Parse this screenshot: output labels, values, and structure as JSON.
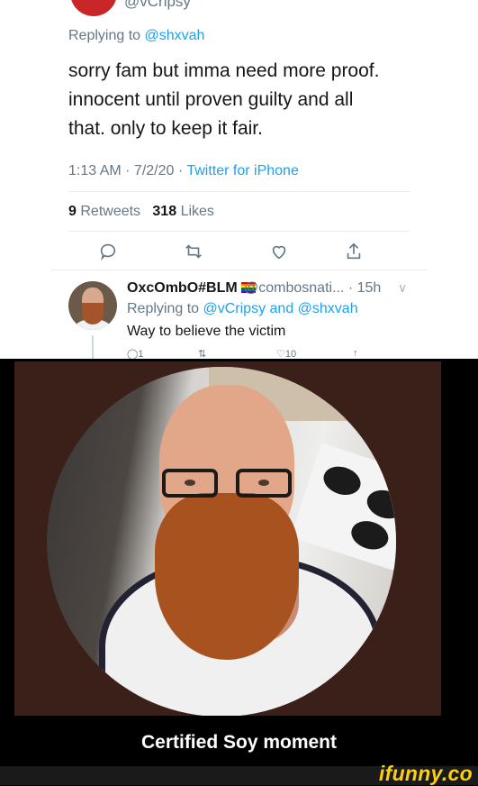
{
  "tweet": {
    "author_handle": "@vCripsy",
    "replying_prefix": "Replying to ",
    "replying_to": "@shxvah",
    "text_lines": [
      "sorry fam but imma need more proof.",
      "innocent until proven guilty and all",
      "that. only to keep it fair."
    ],
    "time": "1:13 AM · 7/2/20 · ",
    "source": "Twitter for iPhone",
    "retweets_count": "9",
    "retweets_label": "Retweets",
    "likes_count": "318",
    "likes_label": "Likes",
    "actions": [
      "reply-icon",
      "retweet-icon",
      "heart-icon",
      "share-icon"
    ]
  },
  "reply": {
    "display_name": "OxcOmbO#BLM",
    "handle_time": "@combosnati... · 15h",
    "chevron": "∨",
    "replying_prefix": "Replying to ",
    "replying_to": "@vCripsy and @shxvah",
    "text": "Way to believe the victim",
    "reply_count": "1",
    "like_count": "10"
  },
  "caption": "Certified Soy moment",
  "watermark": "ifunny.co",
  "colors": {
    "link": "#1da1f2",
    "muted": "#657786",
    "photo_background": "#3b1f19",
    "logo": "#fbce0f"
  }
}
